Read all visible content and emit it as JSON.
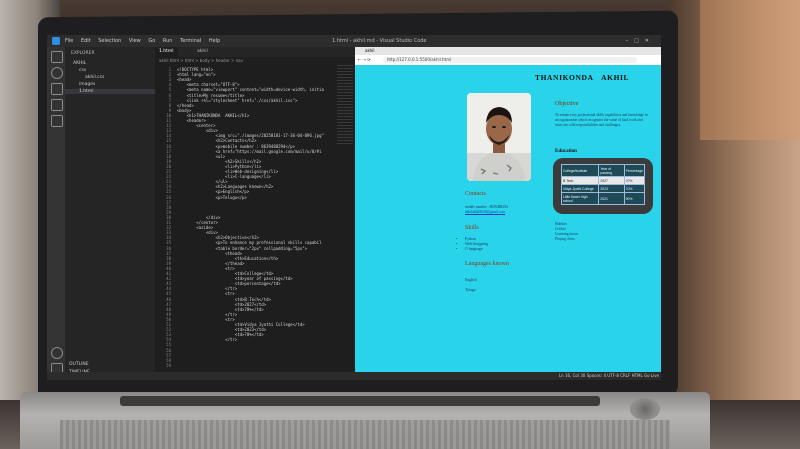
{
  "vscode": {
    "menu": [
      "File",
      "Edit",
      "Selection",
      "View",
      "Go",
      "Run",
      "Terminal",
      "Help"
    ],
    "window_title": "1.html - akhil.md - Visual Studio Code",
    "explorer_header": "EXPLORER",
    "explorer_items": [
      "AKHIL",
      "css",
      "akhil.css",
      "images",
      "1.html"
    ],
    "tabs": [
      "1.html",
      "akhil"
    ],
    "breadcrumb": "akhil.html > html > body > header > nav",
    "line_numbers": [
      "1",
      "2",
      "3",
      "4",
      "5",
      "6",
      "7",
      "8",
      "9",
      "10",
      "11",
      "12",
      "13",
      "14",
      "15",
      "16",
      "17",
      "18",
      "19",
      "20",
      "21",
      "22",
      "23",
      "24",
      "25",
      "26",
      "27",
      "28",
      "29",
      "30",
      "31",
      "32",
      "33",
      "34",
      "35",
      "36",
      "37",
      "38",
      "39",
      "40",
      "41",
      "42",
      "43",
      "44",
      "45",
      "46",
      "47",
      "48",
      "49",
      "50",
      "51",
      "52",
      "53",
      "54",
      "55",
      "56",
      "57",
      "58",
      "59"
    ],
    "code_lines": [
      "<!DOCTYPE html>",
      "<html lang=\"en\">",
      "<head>",
      "    <meta charset=\"UTF-8\">",
      "    <meta name=\"viewport\" content=\"width=device-width, initia",
      "    <title>My resume</title>",
      "    <link rel=\"stylesheet\" href=\"./css/akhil.css\">",
      "</head>",
      "<body>",
      "    <h1>THANIKONDA  AKHIL</h1>",
      "    <header>",
      "        <center>",
      "            <div>",
      "                <img src=\"./images/20250101-17-36-04-096.jpg\"",
      "                <h2>Contacts</h2>",
      "                <p>mobile number : 8639488294</p>",
      "                <a href=\"https://mail.google.com/mail/u/0/#i",
      "                <ul>",
      "                    <h2>Skills</h2>",
      "                    <li>Python</li>",
      "                    <li>Web-designing</li>",
      "                    <li>C-language</li>",
      "                </ul>",
      "                <h2>Languages known</h2>",
      "                <p>English</p>",
      "                <p>Telugu</p>",
      "",
      "",
      "",
      "            </div>",
      "        </center>",
      "        <aside>",
      "            <div>",
      "                <h2>Objective</h2>",
      "                <p>To enhance my professional skills capabil",
      "                <table border=\"2px\" cellpadding=\"5px\">",
      "                    <thead>",
      "                        <th>Education</th>",
      "                    </thead>",
      "                    <tr>",
      "                        <td>College</td>",
      "                        <td>year of passing</td>",
      "                        <td>percentage</td>",
      "                    </tr>",
      "                    <tr>",
      "                        <td>B.Tech</td>",
      "                        <td>2027</td>",
      "                        <td>70%</td>",
      "                    </tr>",
      "                    <tr>",
      "                        <td>Vidya Jyothi College</td>",
      "                        <td>2023</td>",
      "                        <td>70%</td>",
      "                    </tr>",
      "",
      "",
      "",
      "",
      ""
    ],
    "outline": "OUTLINE",
    "timeline": "TIMELINE",
    "status_right": "Ln 16, Col 30   Spaces: 4   UTF-8   CRLF   HTML   Go Live"
  },
  "browser": {
    "tab_title": "akhil",
    "url": "http://127.0.0.1:5500/akhil.html"
  },
  "resume": {
    "name": "THANIKONDA   AKHIL",
    "objective_title": "Objective",
    "objective_text": "To enhance my professional skills capabilities and knowledge in an organization which recognizes the value of hard work and trusts me with responsibilities and challenges.",
    "education_title": "Education",
    "education_table": [
      [
        "College/Institute",
        "Year of passing",
        "Percentage"
      ],
      [
        "B.Tech",
        "2027",
        "70%"
      ],
      [
        "Vidya Jyothi College",
        "2023",
        "70%"
      ],
      [
        "Little flower high school",
        "2021",
        "90%"
      ]
    ],
    "contacts_title": "Contacts",
    "contact_mobile": "mobile number : 8639488294",
    "contact_email": "akhilakhil8639@gmail.com",
    "hobbies": [
      "Hobbies",
      "Cricket",
      "Listening music",
      "Playing chess"
    ],
    "skills_title": "Skills",
    "skills": [
      "Python",
      "Web-designing",
      "C-language"
    ],
    "languages_title": "Languages known",
    "languages": [
      "English",
      "Telugu"
    ]
  }
}
